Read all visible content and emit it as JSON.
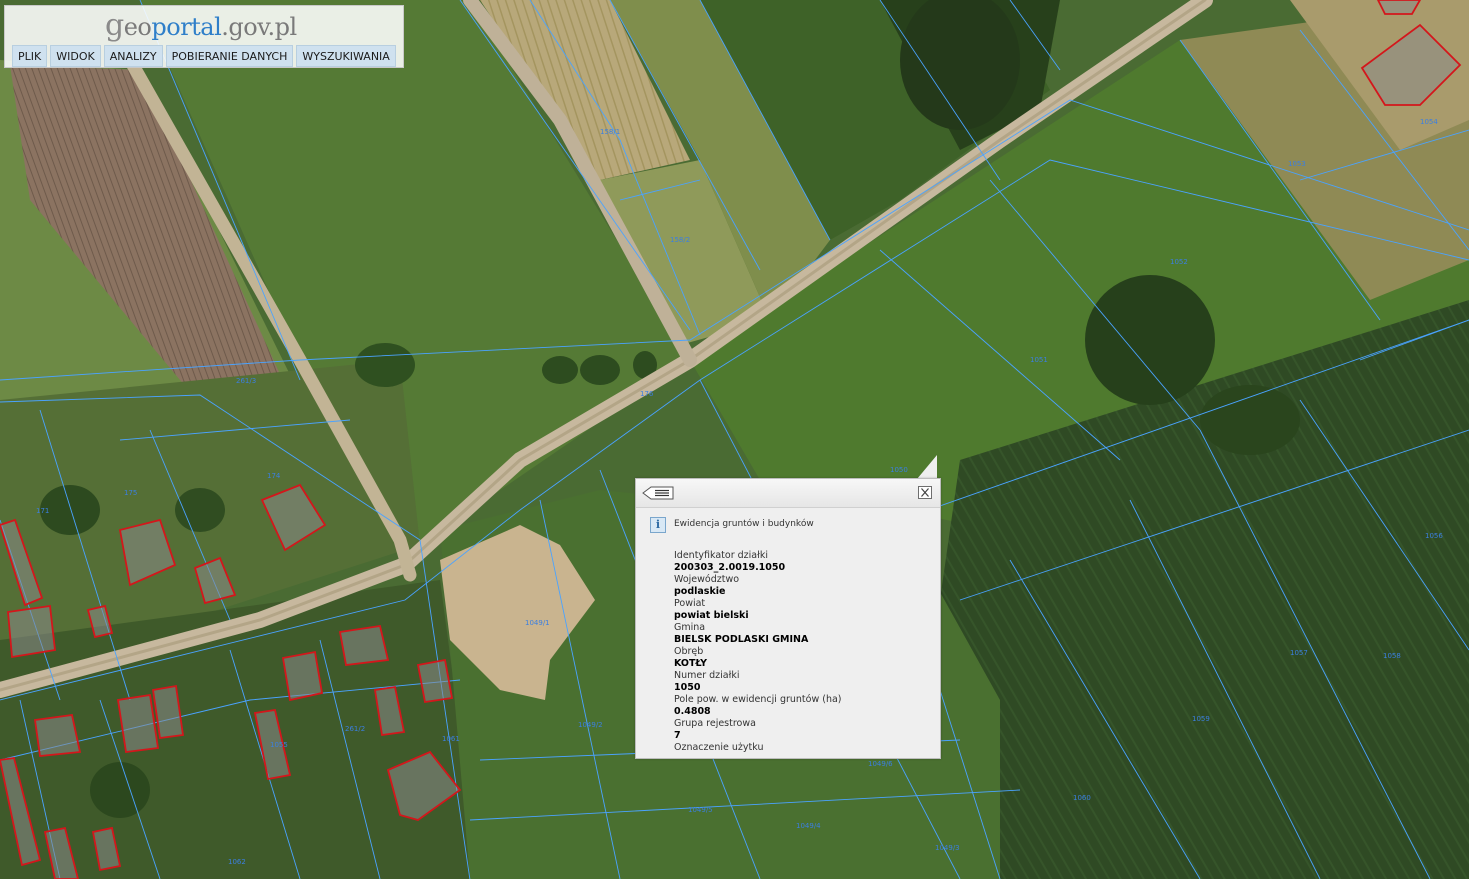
{
  "app": {
    "logo": {
      "g": "g",
      "part1": "eo",
      "part2": "portal",
      "part3": ".gov.pl"
    },
    "menu": [
      "PLIK",
      "WIDOK",
      "ANALIZY",
      "POBIERANIE DANYCH",
      "WYSZUKIWANIA"
    ]
  },
  "colors": {
    "parcel_line": "#4aa3ff",
    "building_outline": "#d4161b",
    "parcel_label": "#3b7fe0",
    "menu_bg": "#cfe1ef",
    "popup_bg": "#efefef"
  },
  "map": {
    "parcel_labels": [
      "261/3",
      "261/2",
      "176",
      "175",
      "174",
      "171",
      "158/1",
      "158/2",
      "1049/1",
      "1049/2",
      "1049/3",
      "1049/4",
      "1049/5",
      "1049/6",
      "1050",
      "1051",
      "1052",
      "1053",
      "1054",
      "1055",
      "1056",
      "1057",
      "1058",
      "1059",
      "1060",
      "1061",
      "1062",
      "1063",
      "1064",
      "1065",
      "1066",
      "1067",
      "1068",
      "1069"
    ]
  },
  "popup": {
    "menu_icon": "list-menu-icon",
    "close_icon": "close-icon",
    "info_icon": "info-icon",
    "info_glyph": "i",
    "header": "Ewidencja gruntów i budynków",
    "fields": [
      {
        "label": "Identyfikator działki",
        "value": "200303_2.0019.1050"
      },
      {
        "label": "Województwo",
        "value": "podlaskie"
      },
      {
        "label": "Powiat",
        "value": "powiat bielski"
      },
      {
        "label": "Gmina",
        "value": "BIELSK PODLASKI GMINA"
      },
      {
        "label": "Obręb",
        "value": "KOTŁY"
      },
      {
        "label": "Numer działki",
        "value": "1050"
      },
      {
        "label": "Pole pow. w ewidencji gruntów (ha)",
        "value": "0.4808"
      },
      {
        "label": "Grupa rejestrowa",
        "value": "7"
      },
      {
        "label": "Oznaczenie użytku",
        "value": ""
      }
    ]
  }
}
